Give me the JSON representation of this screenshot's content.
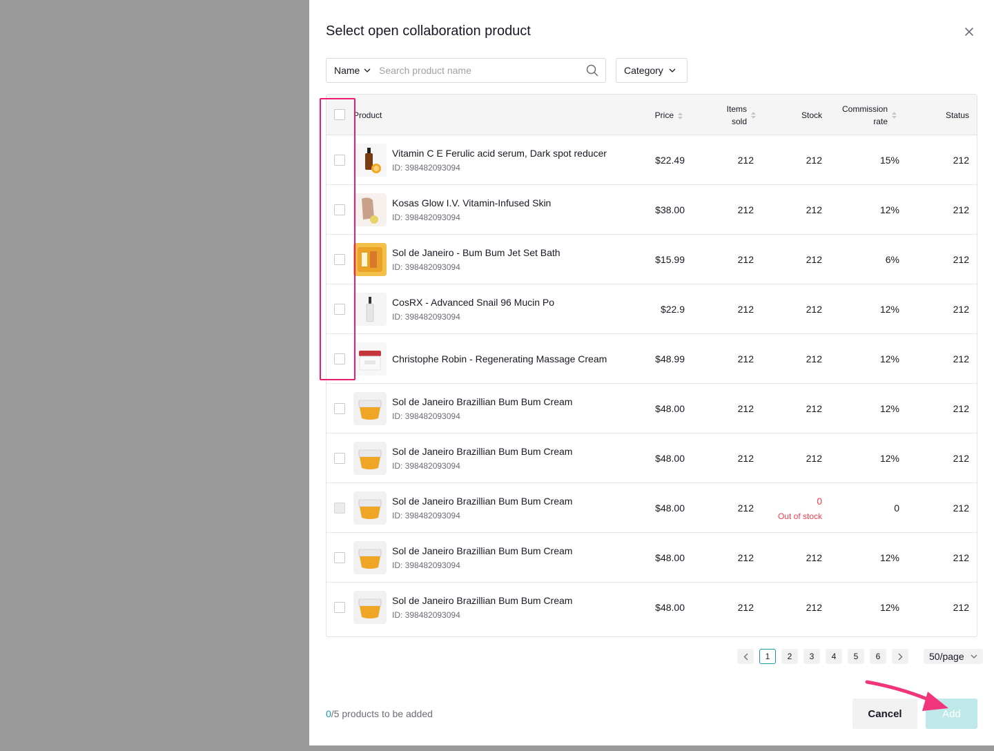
{
  "modal": {
    "title": "Select open collaboration product",
    "search": {
      "field_select": "Name",
      "placeholder": "Search product name"
    },
    "category_label": "Category"
  },
  "table": {
    "headers": {
      "product": "Product",
      "price": "Price",
      "items_sold_1": "Items",
      "items_sold_2": "sold",
      "stock": "Stock",
      "commission_1": "Commission",
      "commission_2": "rate",
      "status": "Status"
    },
    "rows": [
      {
        "name": "Vitamin C E Ferulic acid serum, Dark spot reducer",
        "id": "ID: 398482093094",
        "price": "$22.49",
        "sold": "212",
        "stock": "212",
        "commission": "15%",
        "status": "212"
      },
      {
        "name": "Kosas Glow I.V. Vitamin-Infused Skin",
        "id": "ID: 398482093094",
        "price": "$38.00",
        "sold": "212",
        "stock": "212",
        "commission": "12%",
        "status": "212"
      },
      {
        "name": "Sol de Janeiro - Bum Bum Jet Set Bath",
        "id": "ID: 398482093094",
        "price": "$15.99",
        "sold": "212",
        "stock": "212",
        "commission": "6%",
        "status": "212"
      },
      {
        "name": "CosRX - Advanced Snail 96 Mucin Po",
        "id": "ID: 398482093094",
        "price": "$22.9",
        "sold": "212",
        "stock": "212",
        "commission": "12%",
        "status": "212"
      },
      {
        "name": "Christophe Robin - Regenerating Massage Cream",
        "id": "",
        "price": "$48.99",
        "sold": "212",
        "stock": "212",
        "commission": "12%",
        "status": "212"
      },
      {
        "name": "Sol de Janeiro Brazillian Bum Bum Cream",
        "id": "ID: 398482093094",
        "price": "$48.00",
        "sold": "212",
        "stock": "212",
        "commission": "12%",
        "status": "212"
      },
      {
        "name": "Sol de Janeiro Brazillian Bum Bum Cream",
        "id": "ID: 398482093094",
        "price": "$48.00",
        "sold": "212",
        "stock": "212",
        "commission": "12%",
        "status": "212"
      },
      {
        "name": "Sol de Janeiro Brazillian Bum Bum Cream",
        "id": "ID: 398482093094",
        "price": "$48.00",
        "sold": "212",
        "stock": "0",
        "stock_note": "Out of stock",
        "commission": "0",
        "status": "212"
      },
      {
        "name": "Sol de Janeiro Brazillian Bum Bum Cream",
        "id": "ID: 398482093094",
        "price": "$48.00",
        "sold": "212",
        "stock": "212",
        "commission": "12%",
        "status": "212"
      },
      {
        "name": "Sol de Janeiro Brazillian Bum Bum Cream",
        "id": "ID: 398482093094",
        "price": "$48.00",
        "sold": "212",
        "stock": "212",
        "commission": "12%",
        "status": "212"
      }
    ]
  },
  "pagination": {
    "pages": [
      "1",
      "2",
      "3",
      "4",
      "5",
      "6"
    ],
    "current": "1",
    "per_page": "50/page"
  },
  "footer": {
    "count": "0",
    "suffix": "/5 products to be added",
    "cancel": "Cancel",
    "add": "Add"
  },
  "colors": {
    "accent": "#109aa3",
    "highlight": "#ec1a70",
    "error": "#f53b4b",
    "add_disabled": "#bfe9e9"
  }
}
